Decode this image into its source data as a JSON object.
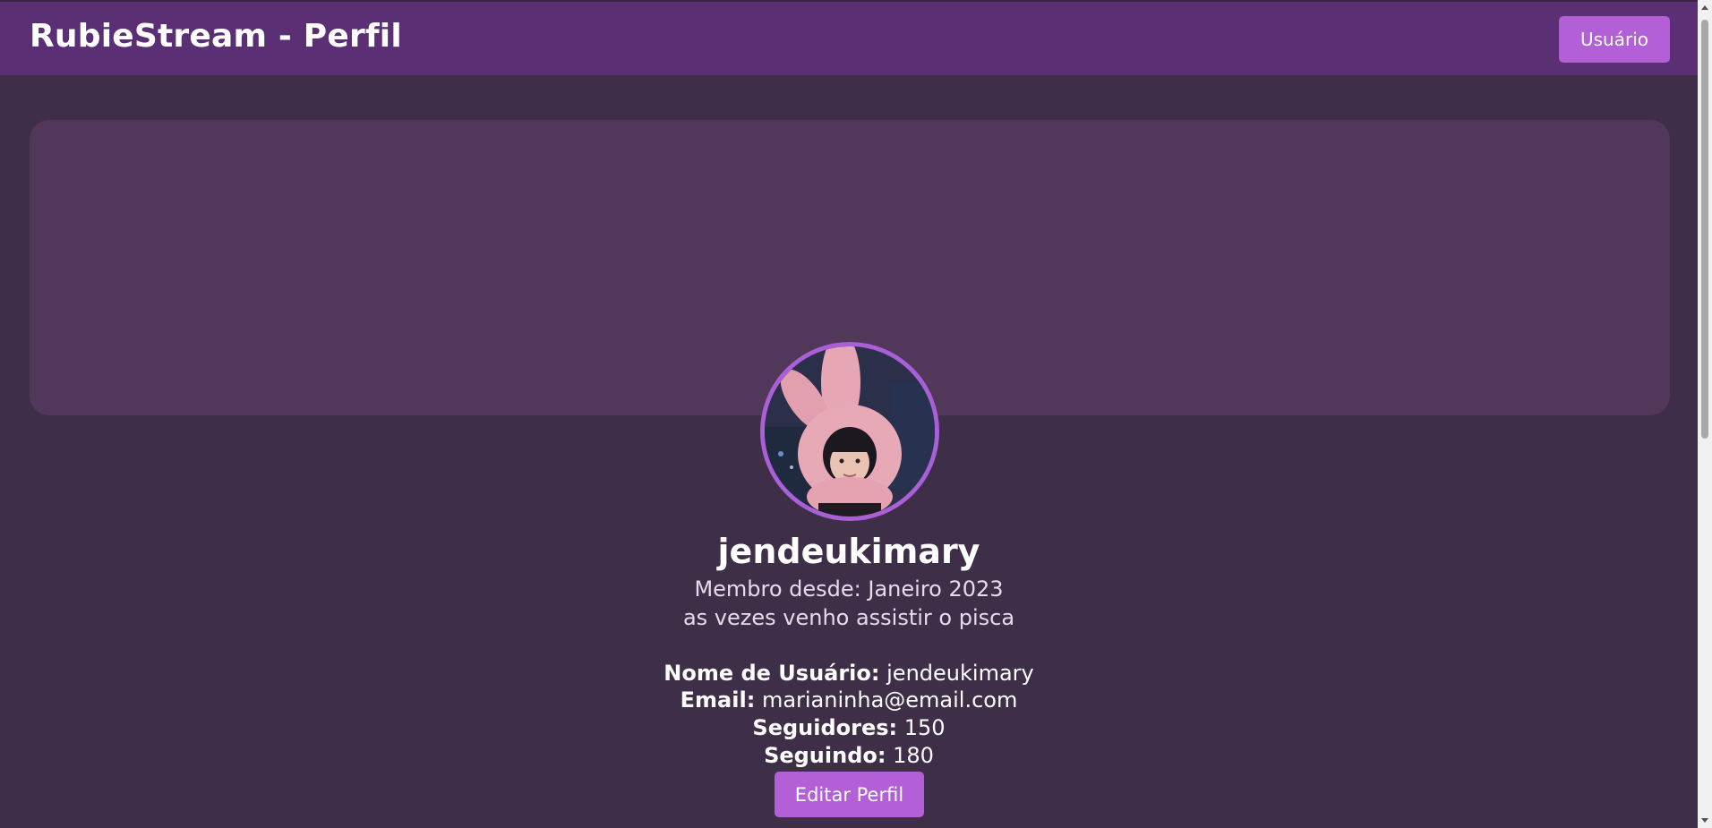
{
  "header": {
    "title": "RubieStream - Perfil",
    "user_button_label": "Usuário"
  },
  "profile": {
    "username": "jendeukimary",
    "member_since": "Membro desde: Janeiro 2023",
    "bio": "as vezes venho assistir o pisca",
    "details": [
      {
        "label": "Nome de Usuário:",
        "value": "jendeukimary"
      },
      {
        "label": "Email:",
        "value": "marianinha@email.com"
      },
      {
        "label": "Seguidores:",
        "value": "150"
      },
      {
        "label": "Seguindo:",
        "value": "180"
      }
    ],
    "edit_button_label": "Editar Perfil"
  },
  "colors": {
    "background": "#3e2e47",
    "header": "#5a2f74",
    "banner": "#51385b",
    "accent": "#b25fd8",
    "avatar_border": "#a95fd6"
  }
}
